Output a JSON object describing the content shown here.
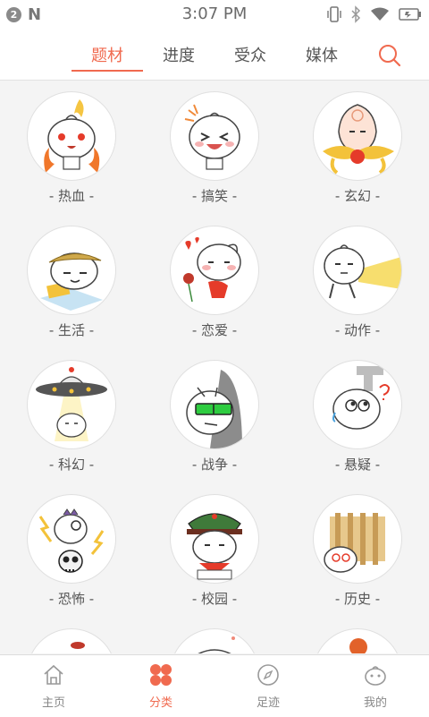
{
  "status_bar": {
    "notification_count": "2",
    "carrier_glyph": "N",
    "time": "3:07 PM",
    "icons": [
      "vibrate-icon",
      "bluetooth-icon",
      "wifi-icon",
      "battery-icon"
    ]
  },
  "top_tabs": [
    {
      "label": "题材",
      "active": true
    },
    {
      "label": "进度",
      "active": false
    },
    {
      "label": "受众",
      "active": false
    },
    {
      "label": "媒体",
      "active": false
    }
  ],
  "search_icon": "search-icon",
  "categories": [
    {
      "label": "- 热血 -",
      "icon": "hot-blood-mascot"
    },
    {
      "label": "- 搞笑 -",
      "icon": "funny-mascot"
    },
    {
      "label": "- 玄幻 -",
      "icon": "fantasy-mascot"
    },
    {
      "label": "- 生活 -",
      "icon": "life-mascot"
    },
    {
      "label": "- 恋爱 -",
      "icon": "romance-mascot"
    },
    {
      "label": "- 动作 -",
      "icon": "action-mascot"
    },
    {
      "label": "- 科幻 -",
      "icon": "scifi-mascot"
    },
    {
      "label": "- 战争 -",
      "icon": "war-mascot"
    },
    {
      "label": "- 悬疑 -",
      "icon": "mystery-mascot"
    },
    {
      "label": "- 恐怖 -",
      "icon": "horror-mascot"
    },
    {
      "label": "- 校园 -",
      "icon": "campus-mascot"
    },
    {
      "label": "- 历史 -",
      "icon": "history-mascot"
    }
  ],
  "bottom_nav": [
    {
      "label": "主页",
      "icon": "home-icon",
      "active": false
    },
    {
      "label": "分类",
      "icon": "category-icon",
      "active": true
    },
    {
      "label": "足迹",
      "icon": "compass-icon",
      "active": false
    },
    {
      "label": "我的",
      "icon": "profile-icon",
      "active": false
    }
  ],
  "colors": {
    "accent": "#f06a4f",
    "background": "#f4f4f4",
    "text": "#555555"
  }
}
